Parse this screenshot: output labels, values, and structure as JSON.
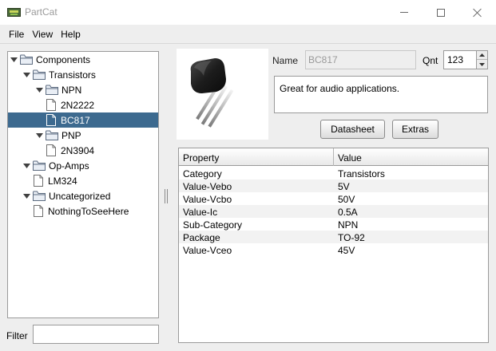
{
  "window": {
    "title": "PartCat"
  },
  "menu": {
    "items": [
      "File",
      "View",
      "Help"
    ]
  },
  "tree": {
    "nodes": [
      {
        "label": "Components",
        "type": "folder",
        "expanded": true
      },
      {
        "label": "Transistors",
        "type": "folder",
        "expanded": true
      },
      {
        "label": "NPN",
        "type": "folder",
        "expanded": true
      },
      {
        "label": "2N2222",
        "type": "file"
      },
      {
        "label": "BC817",
        "type": "file",
        "selected": true
      },
      {
        "label": "PNP",
        "type": "folder",
        "expanded": true
      },
      {
        "label": "2N3904",
        "type": "file"
      },
      {
        "label": "Op-Amps",
        "type": "folder",
        "expanded": true
      },
      {
        "label": "LM324",
        "type": "file"
      },
      {
        "label": "Uncategorized",
        "type": "folder",
        "expanded": true
      },
      {
        "label": "NothingToSeeHere",
        "type": "file"
      }
    ]
  },
  "filter": {
    "label": "Filter",
    "value": ""
  },
  "detail": {
    "name_label": "Name",
    "name_value": "BC817",
    "qnt_label": "Qnt",
    "qnt_value": "123",
    "description": "Great for audio applications.",
    "datasheet_label": "Datasheet",
    "extras_label": "Extras"
  },
  "properties": {
    "columns": [
      "Property",
      "Value"
    ],
    "rows": [
      {
        "property": "Category",
        "value": "Transistors"
      },
      {
        "property": "Value-Vebo",
        "value": "5V"
      },
      {
        "property": "Value-Vcbo",
        "value": "50V"
      },
      {
        "property": "Value-Ic",
        "value": "0.5A"
      },
      {
        "property": "Sub-Category",
        "value": "NPN"
      },
      {
        "property": "Package",
        "value": "TO-92"
      },
      {
        "property": "Value-Vceo",
        "value": "45V"
      }
    ]
  },
  "colors": {
    "selection": "#3d6a8f",
    "panel_background": "#eeeeee",
    "folder": "#7f8fa6"
  },
  "icons": {
    "folder": "folder-icon",
    "file": "file-icon",
    "expand": "triangle-down-icon"
  }
}
